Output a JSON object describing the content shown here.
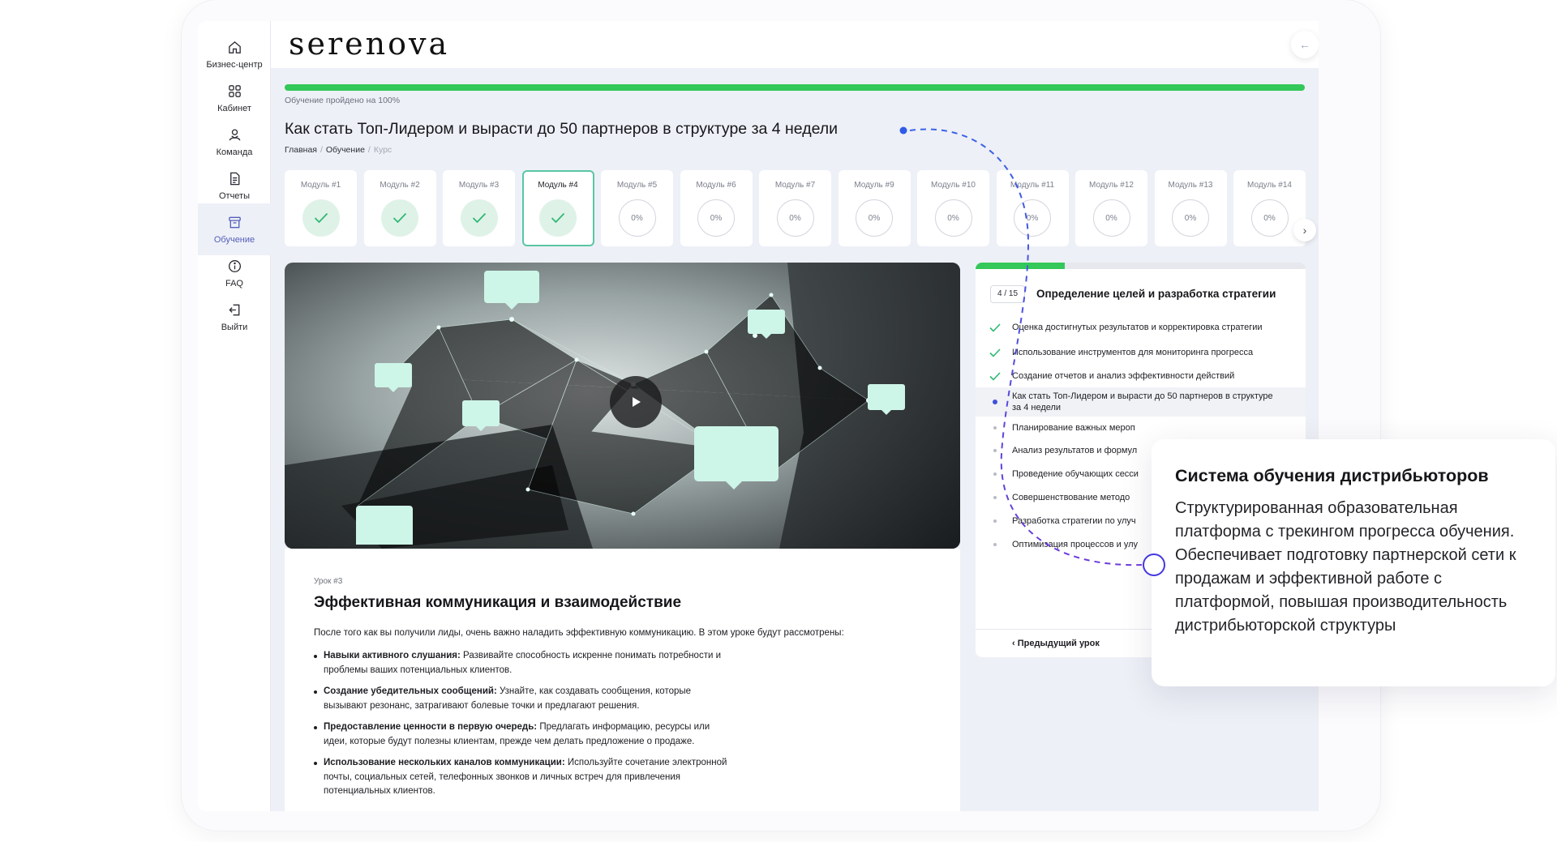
{
  "brand": {
    "logo": "serenova"
  },
  "header": {
    "back_icon": "arrow-left-icon"
  },
  "sidebar": {
    "items": [
      {
        "label": "Бизнес-центр",
        "icon": "home-icon"
      },
      {
        "label": "Кабинет",
        "icon": "grid-icon"
      },
      {
        "label": "Команда",
        "icon": "team-icon"
      },
      {
        "label": "Отчеты",
        "icon": "document-icon"
      },
      {
        "label": "Обучение",
        "icon": "archive-icon",
        "active": true
      },
      {
        "label": "FAQ",
        "icon": "info-icon"
      },
      {
        "label": "Выйти",
        "icon": "logout-icon"
      }
    ]
  },
  "course": {
    "progress_text": "Обучение пройдено на 100%",
    "progress_value": 1.0,
    "title": "Как стать Топ-Лидером и вырасти до 50 партнеров в структуре за 4 недели",
    "breadcrumb": [
      "Главная",
      "Обучение",
      "Курс"
    ],
    "breadcrumb_sep": "/"
  },
  "modules": [
    {
      "label": "Модуль #1",
      "status": "done"
    },
    {
      "label": "Модуль #2",
      "status": "done"
    },
    {
      "label": "Модуль #3",
      "status": "done"
    },
    {
      "label": "Модуль #4",
      "status": "done",
      "active": true
    },
    {
      "label": "Модуль #5",
      "status": "0%"
    },
    {
      "label": "Модуль #6",
      "status": "0%"
    },
    {
      "label": "Модуль #7",
      "status": "0%"
    },
    {
      "label": "Модуль #9",
      "status": "0%"
    },
    {
      "label": "Модуль #10",
      "status": "0%"
    },
    {
      "label": "Модуль #11",
      "status": "0%"
    },
    {
      "label": "Модуль #12",
      "status": "0%"
    },
    {
      "label": "Модуль #13",
      "status": "0%"
    },
    {
      "label": "Модуль #14",
      "status": "0%"
    }
  ],
  "lesson": {
    "number": "Урок #3",
    "title": "Эффективная коммуникация и взаимодействие",
    "intro": "После того как вы получили лиды, очень важно наладить эффективную коммуникацию. В этом уроке будут рассмотрены:",
    "bullets": [
      {
        "bold": "Навыки активного слушания:",
        "text": " Развивайте способность искренне понимать потребности и проблемы ваших потенциальных клиентов."
      },
      {
        "bold": "Создание убедительных сообщений:",
        "text": " Узнайте, как создавать сообщения, которые вызывают резонанс, затрагивают болевые точки и предлагают решения."
      },
      {
        "bold": "Предоставление ценности в первую очередь:",
        "text": " Предлагать информацию, ресурсы или идеи, которые будут полезны клиентам, прежде чем делать предложение о продаже."
      },
      {
        "bold": "Использование нескольких каналов коммуникации:",
        "text": " Используйте сочетание электронной почты, социальных сетей, телефонных звонков и личных встреч для привлечения потенциальных клиентов."
      }
    ]
  },
  "module_panel": {
    "step": "4 / 15",
    "step_progress": 0.27,
    "title": "Определение целей и разработка стратегии",
    "lessons": [
      {
        "label": "Оценка достигнутых результатов и корректировка стратегии",
        "state": "done"
      },
      {
        "label": "Использование инструментов для мониторинга прогресса",
        "state": "done"
      },
      {
        "label": "Создание отчетов и анализ эффективности действий",
        "state": "done"
      },
      {
        "label": "Как стать Топ-Лидером и вырасти до 50 партнеров в структуре за 4 недели",
        "state": "current"
      },
      {
        "label": "Планирование важных мероп",
        "state": "todo"
      },
      {
        "label": "Анализ результатов и формул",
        "state": "todo"
      },
      {
        "label": "Проведение обучающих сесси",
        "state": "todo"
      },
      {
        "label": "Совершенствование методо",
        "state": "todo"
      },
      {
        "label": "Разработка стратегии по улуч",
        "state": "todo"
      },
      {
        "label": "Оптимизация процессов и улу",
        "state": "todo"
      }
    ],
    "prev_button": "Предыдущий урок"
  },
  "callout": {
    "title": "Система обучения дистрибьюторов",
    "body": "Структурированная образовательная платформа с трекингом прогресса обучения. Обеспечивает подготовку партнерской сети к продажам и эффективной работе с платформой, повышая производительность дистрибьюторской структуры"
  },
  "colors": {
    "accent_green": "#34c759",
    "check_green": "#2fb873",
    "active_nav": "#5360b7",
    "callout_line": "#3a4ee0"
  }
}
